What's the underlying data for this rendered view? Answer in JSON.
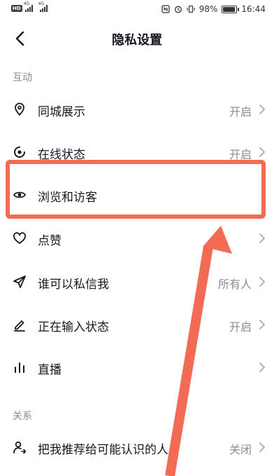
{
  "status_bar": {
    "left_badge": "HD",
    "net1": "4G",
    "net2": "4G",
    "battery_text": "98%",
    "battery_level": 0.98,
    "time": "16:44"
  },
  "header": {
    "title": "隐私设置"
  },
  "sections": [
    {
      "label": "互动",
      "items": [
        {
          "label": "同城展示",
          "value": "开启",
          "icon": "location-pin-icon"
        },
        {
          "label": "在线状态",
          "value": "开启",
          "icon": "online-status-icon"
        },
        {
          "label": "浏览和访客",
          "value": "",
          "icon": "eye-icon"
        },
        {
          "label": "点赞",
          "value": "",
          "icon": "heart-icon"
        },
        {
          "label": "谁可以私信我",
          "value": "所有人",
          "icon": "paper-plane-icon"
        },
        {
          "label": "正在输入状态",
          "value": "开启",
          "icon": "pencil-icon"
        },
        {
          "label": "直播",
          "value": "",
          "icon": "bar-chart-icon"
        }
      ]
    },
    {
      "label": "关系",
      "items": [
        {
          "label": "把我推荐给可能认识的人",
          "value": "关闭",
          "icon": "person-share-icon"
        }
      ]
    }
  ],
  "annotation": {
    "highlight_color": "#f26b55"
  }
}
